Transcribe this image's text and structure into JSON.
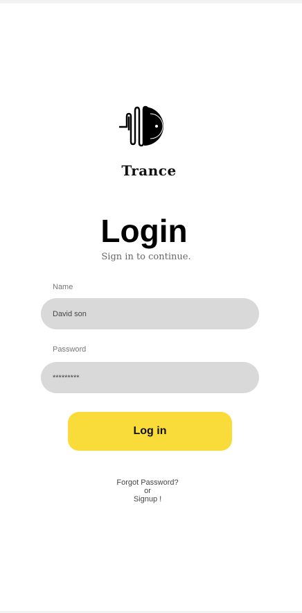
{
  "app": {
    "brand": "Trance"
  },
  "header": {
    "title": "Login",
    "subtitle": "Sign in to continue."
  },
  "form": {
    "name": {
      "label": "Name",
      "value": "David son"
    },
    "password": {
      "label": "Password",
      "value": "*********"
    },
    "submit_label": "Log in"
  },
  "footer": {
    "forgot_label": "Forgot Password?",
    "or_label": "or",
    "signup_label": "Signup !"
  },
  "colors": {
    "accent": "#f9db3a",
    "field_bg": "#d9d9d9"
  },
  "icons": {
    "logo": "vinyl-record-soundwave-icon"
  }
}
